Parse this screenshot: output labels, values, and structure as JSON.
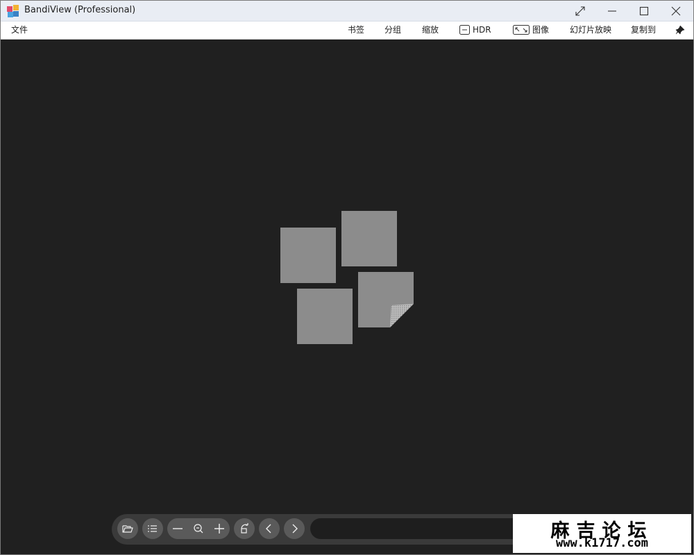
{
  "window": {
    "title": "BandiView (Professional)"
  },
  "menu": {
    "file": "文件",
    "bookmark": "书签",
    "group": "分组",
    "zoom": "缩放",
    "hdr": "HDR",
    "image": "图像",
    "slideshow": "幻灯片放映",
    "copy_to": "复制到"
  },
  "watermark": {
    "title": "麻吉论坛",
    "url": "www.k1717.com"
  },
  "colors": {
    "titlebar_bg": "#e9edf4",
    "viewer_bg": "#202020",
    "placeholder": "#8c8c8c",
    "toolbar_bg": "#3a3a3a",
    "toolbar_button": "#5a5a5a"
  },
  "icons": {
    "app": "bandiview-logo-icon",
    "fullscreen": "expand-arrows-icon",
    "minimize": "minimize-icon",
    "maximize": "maximize-icon",
    "close": "close-icon",
    "pin": "pin-icon",
    "open_folder": "folder-open-icon",
    "list": "list-icon",
    "zoom_out": "minus-icon",
    "zoom_fit": "magnifier-icon",
    "zoom_in": "plus-icon",
    "rotate": "rotate-icon",
    "prev": "chevron-left-icon",
    "next": "chevron-right-icon"
  }
}
